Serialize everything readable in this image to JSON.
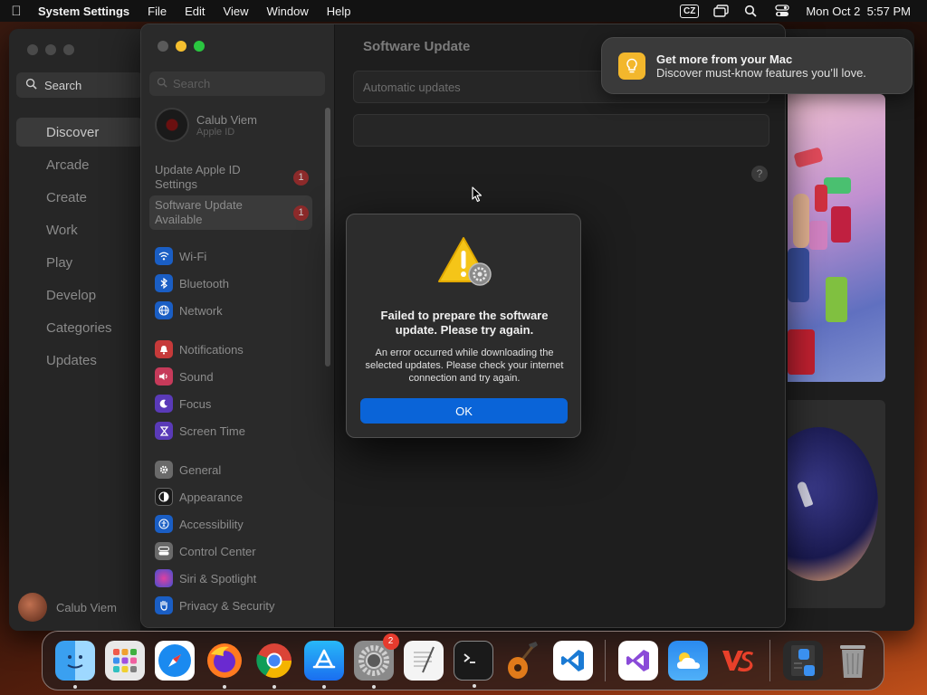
{
  "menubar": {
    "app_name": "System Settings",
    "menus": [
      "File",
      "Edit",
      "View",
      "Window",
      "Help"
    ],
    "input_source": "CZ",
    "clock": "Mon Oct 2  5:57 PM"
  },
  "appstore": {
    "search_label": "Search",
    "nav": [
      "Discover",
      "Arcade",
      "Create",
      "Work",
      "Play",
      "Develop",
      "Categories",
      "Updates"
    ],
    "user_name": "Calub Viem"
  },
  "settings": {
    "search_placeholder": "Search",
    "apple_id": {
      "name": "Calub Viem",
      "subtitle": "Apple ID"
    },
    "notices": [
      {
        "label": "Update Apple ID Settings",
        "badge": "1"
      },
      {
        "label": "Software Update Available",
        "badge": "1"
      }
    ],
    "group1": [
      "Wi-Fi",
      "Bluetooth",
      "Network"
    ],
    "group2": [
      "Notifications",
      "Sound",
      "Focus",
      "Screen Time"
    ],
    "group3": [
      "General",
      "Appearance",
      "Accessibility",
      "Control Center",
      "Siri & Spotlight",
      "Privacy & Security"
    ],
    "main_title": "Software Update",
    "automatic_updates_label": "Automatic updates",
    "help": "?"
  },
  "notification": {
    "title": "Get more from your Mac",
    "body": "Discover must-know features you’ll love."
  },
  "alert": {
    "title": "Failed to prepare the software update. Please try again.",
    "message": "An error occurred while downloading the selected updates. Please check your internet connection and try again.",
    "ok_label": "OK"
  },
  "dock": {
    "settings_badge": "2",
    "apps": [
      "Finder",
      "Launchpad",
      "Safari",
      "Firefox",
      "Chrome",
      "App Store",
      "System Settings",
      "TextEdit",
      "Terminal",
      "GarageBand",
      "Visual Studio Code",
      "Visual Studio",
      "Weather",
      "VS",
      "Downloads",
      "Trash"
    ]
  },
  "colors": {
    "accent": "#0a64d8",
    "badge_red": "#e63b2e",
    "traffic_yellow": "#f5bf2f",
    "traffic_green": "#2ac640"
  }
}
